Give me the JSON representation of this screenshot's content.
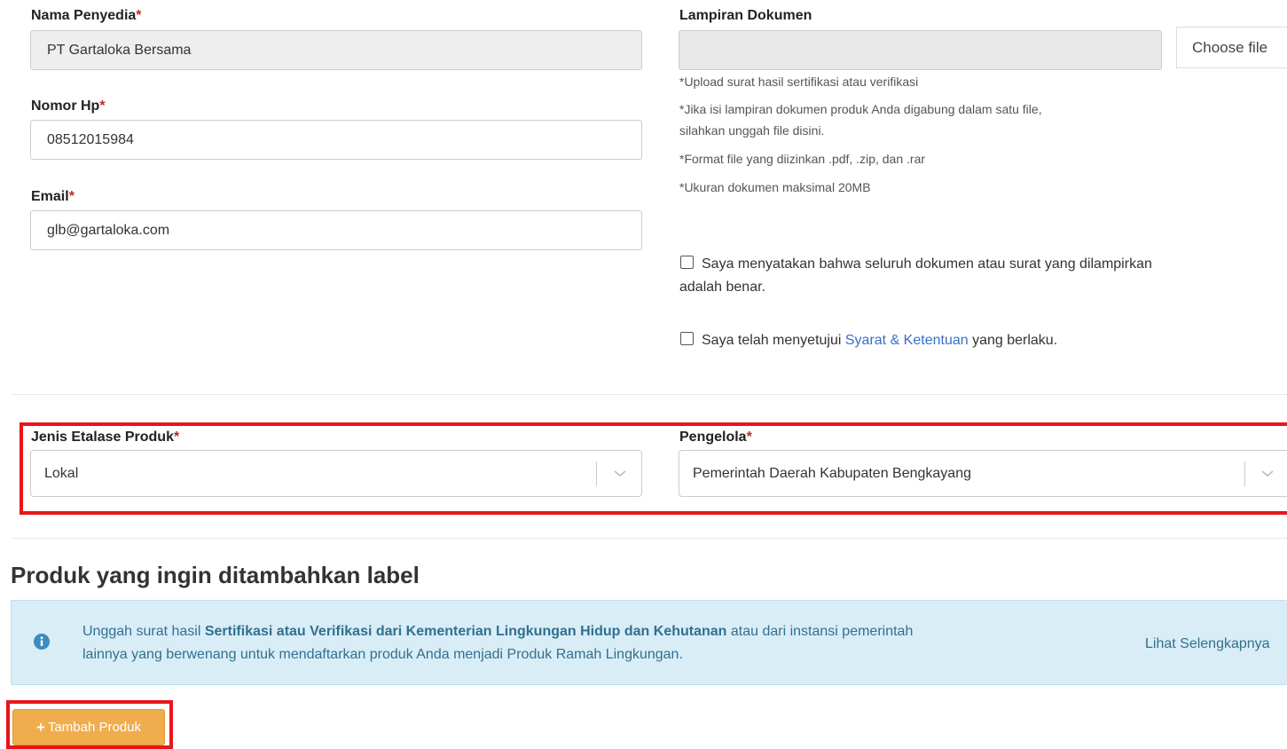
{
  "form": {
    "nama_penyedia": {
      "label": "Nama Penyedia",
      "required_mark": "*",
      "value": "PT Gartaloka Bersama"
    },
    "nomor_hp": {
      "label": "Nomor Hp",
      "required_mark": "*",
      "value": "08512015984"
    },
    "email": {
      "label": "Email",
      "required_mark": "*",
      "value": "glb@gartaloka.com"
    },
    "lampiran": {
      "label": "Lampiran Dokumen",
      "choose_label": "Choose file",
      "notes": [
        "*Upload surat hasil sertifikasi atau verifikasi",
        "*Jika isi lampiran dokumen produk Anda digabung dalam satu file,",
        "silahkan unggah file disini.",
        "*Format file yang diizinkan .pdf, .zip, dan .rar",
        "*Ukuran dokumen maksimal 20MB"
      ]
    },
    "agree_docs": {
      "line1": "Saya menyatakan bahwa seluruh dokumen atau surat yang dilampirkan",
      "line2": "adalah benar.",
      "checked": false
    },
    "agree_terms": {
      "prefix": "Saya telah menyetujui ",
      "link": "Syarat & Ketentuan",
      "suffix": " yang berlaku.",
      "checked": false
    },
    "jenis_etalase": {
      "label": "Jenis Etalase Produk",
      "required_mark": "*",
      "value": "Lokal"
    },
    "pengelola": {
      "label": "Pengelola",
      "required_mark": "*",
      "value": "Pemerintah Daerah Kabupaten Bengkayang"
    }
  },
  "section": {
    "title": "Produk yang ingin ditambahkan label",
    "alert": {
      "text_before": "Unggah surat hasil ",
      "text_bold": "Sertifikasi atau Verifikasi dari Kementerian Lingkungan Hidup dan Kehutanan",
      "text_after": " atau dari instansi pemerintah",
      "text_line2": "lainnya yang berwenang untuk mendaftarkan produk Anda menjadi Produk Ramah Lingkungan.",
      "link": "Lihat Selengkapnya",
      "icon": "info-circle-icon"
    },
    "add_button": {
      "icon_text": "+",
      "label": "Tambah Produk"
    }
  },
  "colors": {
    "required": "#c0272d",
    "highlight_box": "#e8151b",
    "alert_bg": "#d9edf7",
    "alert_text": "#31708f",
    "button": "#f0ad4e",
    "link": "#3a6fc4"
  }
}
